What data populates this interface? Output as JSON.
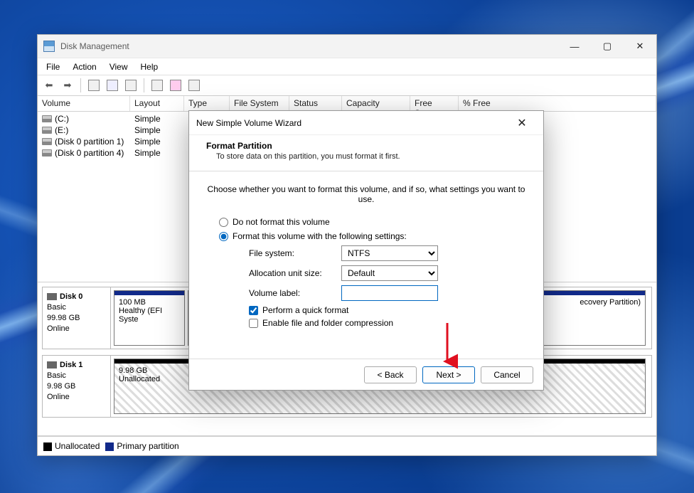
{
  "window": {
    "title": "Disk Management",
    "menu": {
      "file": "File",
      "action": "Action",
      "view": "View",
      "help": "Help"
    },
    "columns": {
      "volume": "Volume",
      "layout": "Layout",
      "type": "Type",
      "fs": "File System",
      "status": "Status",
      "capacity": "Capacity",
      "free": "Free Spa...",
      "pct": "% Free"
    },
    "rows": [
      {
        "volume": "(C:)",
        "layout": "Simple"
      },
      {
        "volume": "(E:)",
        "layout": "Simple"
      },
      {
        "volume": "(Disk 0 partition 1)",
        "layout": "Simple"
      },
      {
        "volume": "(Disk 0 partition 4)",
        "layout": "Simple"
      }
    ],
    "disks": {
      "d0": {
        "name": "Disk 0",
        "type": "Basic",
        "size": "99.98 GB",
        "status": "Online",
        "p0_size": "100 MB",
        "p0_status": "Healthy (EFI Syste",
        "p1_status": "ecovery Partition)"
      },
      "d1": {
        "name": "Disk 1",
        "type": "Basic",
        "size": "9.98 GB",
        "status": "Online",
        "p0_size": "9.98 GB",
        "p0_status": "Unallocated"
      }
    },
    "legend": {
      "unalloc": "Unallocated",
      "primary": "Primary partition"
    }
  },
  "wizard": {
    "title": "New Simple Volume Wizard",
    "heading": "Format Partition",
    "subheading": "To store data on this partition, you must format it first.",
    "intro": "Choose whether you want to format this volume, and if so, what settings you want to use.",
    "opt_noformat": "Do not format this volume",
    "opt_format": "Format this volume with the following settings:",
    "lbl_fs": "File system:",
    "lbl_alloc": "Allocation unit size:",
    "lbl_label": "Volume label:",
    "val_fs": "NTFS",
    "val_alloc": "Default",
    "val_label": "",
    "chk_quick": "Perform a quick format",
    "chk_compress": "Enable file and folder compression",
    "btn_back": "< Back",
    "btn_next": "Next >",
    "btn_cancel": "Cancel"
  }
}
